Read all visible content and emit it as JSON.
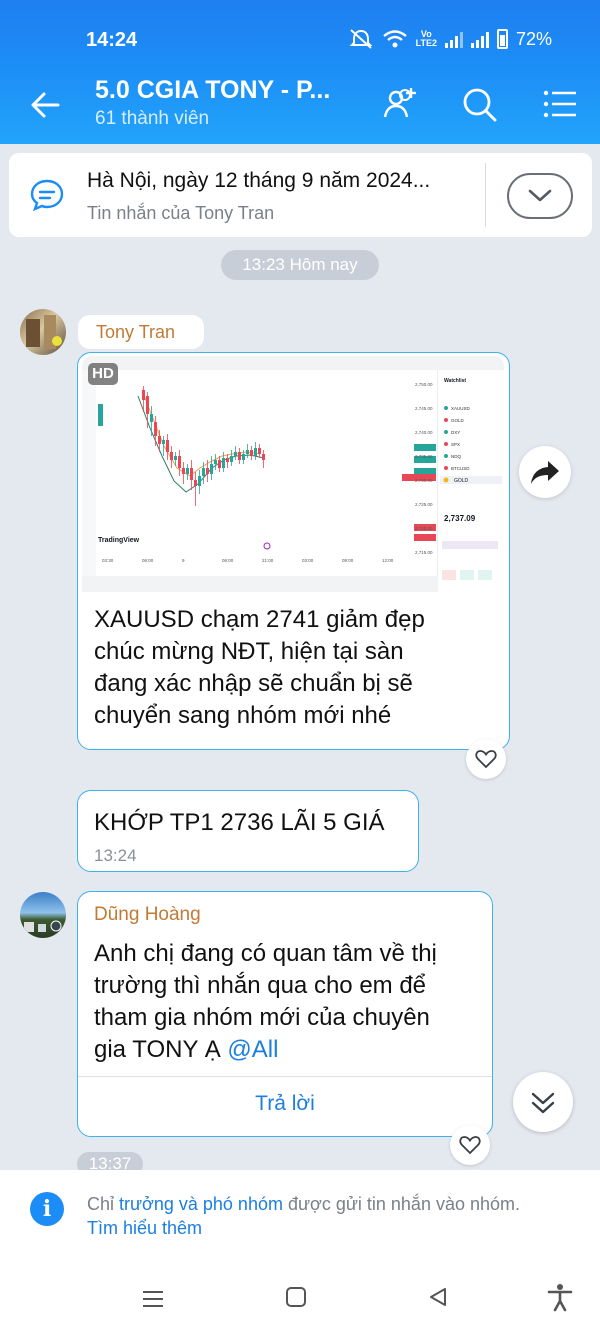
{
  "status": {
    "time": "14:24",
    "battery": "72%",
    "lte_top": "Vo",
    "lte_bottom": "LTE2"
  },
  "header": {
    "title": "5.0 CGIA TONY - P...",
    "subtitle": "61 thành viên"
  },
  "pinned": {
    "title": "Hà Nội, ngày 12 tháng 9 năm 2024...",
    "subtitle": "Tin nhắn của Tony Tran"
  },
  "divider_time": "13:23 Hôm nay",
  "messages": [
    {
      "sender": "Tony Tran",
      "image_badge": "HD",
      "text_lines": [
        "XAUUSD chạm 2741 giảm đẹp",
        "chúc mừng NĐT, hiện tại sàn",
        "đang xác nhập sẽ chuẩn bị sẽ",
        "chuyển sang nhóm mới nhé"
      ]
    },
    {
      "text": "KHỚP TP1 2736 LÃI 5 GIÁ",
      "time": "13:24"
    },
    {
      "sender": "Dũng Hoàng",
      "text_lines": [
        "Anh chị đang có quan tâm về thị",
        "trường thì nhắn qua cho em để",
        "tham gia nhóm mới của chuyên"
      ],
      "last_line": "gia TONY Ạ ",
      "mention": "@All",
      "reply_label": "Trả lời",
      "time": "13:37"
    }
  ],
  "chart_screenshot": {
    "brand": "TradingView",
    "price": "2,737.09",
    "symbol": "GOLD",
    "price_labels": [
      "2,750.00",
      "2,745.00",
      "2,740.00",
      "2,735.00",
      "2,730.00",
      "2,725.00",
      "2,720.00",
      "2,715.00"
    ],
    "time_labels": [
      "03:30",
      "06:00",
      "9",
      "06:00",
      "21:00",
      "03:00",
      "09:00",
      "12:00"
    ],
    "panel_title": "Watchlist",
    "panel_rows": [
      "XAUUSD",
      "GOLD",
      "DXY",
      "SPX",
      "NDQ",
      "BTCUSD"
    ]
  },
  "footer": {
    "notice_prefix": "Chỉ ",
    "notice_link1": "trưởng và phó nhóm",
    "notice_mid": " được gửi tin nhắn vào nhóm.",
    "notice_link2": "Tìm hiểu thêm"
  },
  "colors": {
    "accent": "#1c8df6",
    "bubble_border": "#3fb0ea",
    "sender_tony": "#c27a35"
  }
}
